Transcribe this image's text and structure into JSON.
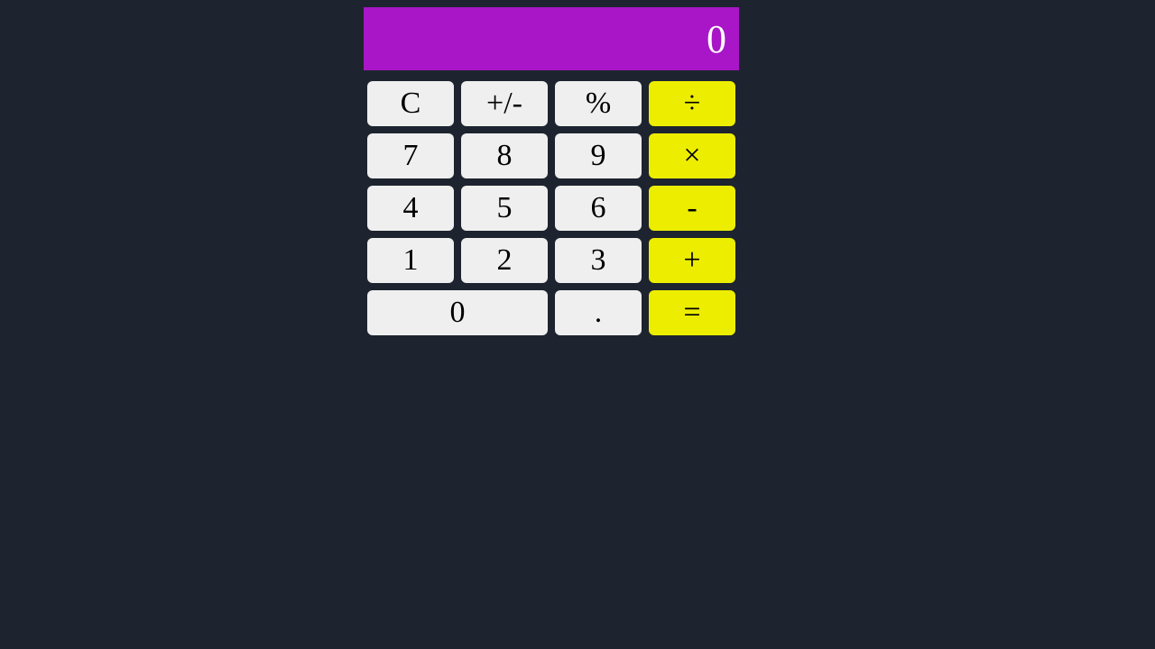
{
  "colors": {
    "background": "#1d242f",
    "display_bg": "#a816c7",
    "display_fg": "#ffffff",
    "button_bg": "#efefef",
    "operator_bg": "#eded00"
  },
  "display": {
    "value": "0"
  },
  "buttons": {
    "clear": "C",
    "negate": "+/-",
    "percent": "%",
    "divide": "÷",
    "seven": "7",
    "eight": "8",
    "nine": "9",
    "multiply": "×",
    "four": "4",
    "five": "5",
    "six": "6",
    "subtract": "-",
    "one": "1",
    "two": "2",
    "three": "3",
    "add": "+",
    "zero": "0",
    "decimal": ".",
    "equals": "="
  }
}
